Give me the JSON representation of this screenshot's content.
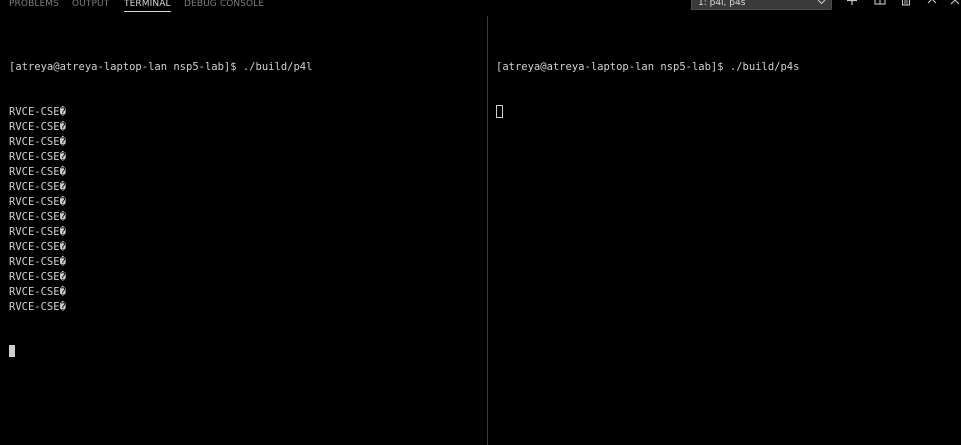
{
  "panel": {
    "tabs": [
      {
        "label": "PROBLEMS"
      },
      {
        "label": "OUTPUT"
      },
      {
        "label": "TERMINAL"
      },
      {
        "label": "DEBUG CONSOLE"
      }
    ],
    "active_tab": "TERMINAL",
    "terminal_selector": {
      "value": "1: p4l, p4s"
    },
    "toolbar_icons": [
      "plus-icon",
      "split-icon",
      "trash-icon",
      "chevron-up-icon",
      "close-icon"
    ]
  },
  "terminals": {
    "left": {
      "prompt": "[atreya@atreya-laptop-lan nsp5-lab]$ ./build/p4l",
      "output": [
        "RVCE-CSE�",
        "RVCE-CSE�",
        "RVCE-CSE�",
        "RVCE-CSE�",
        "RVCE-CSE�",
        "RVCE-CSE�",
        "RVCE-CSE�",
        "RVCE-CSE�",
        "RVCE-CSE�",
        "RVCE-CSE�",
        "RVCE-CSE�",
        "RVCE-CSE�",
        "RVCE-CSE�",
        "RVCE-CSE�"
      ]
    },
    "right": {
      "prompt": "[atreya@atreya-laptop-lan nsp5-lab]$ ./build/p4s"
    }
  },
  "colors": {
    "background": "#000000",
    "text": "#d0d0d0",
    "tab_inactive": "#7d7d7d",
    "tab_active": "#d6d6d6",
    "selector_bg": "#3a3a3a",
    "divider": "#3c3c3c"
  }
}
